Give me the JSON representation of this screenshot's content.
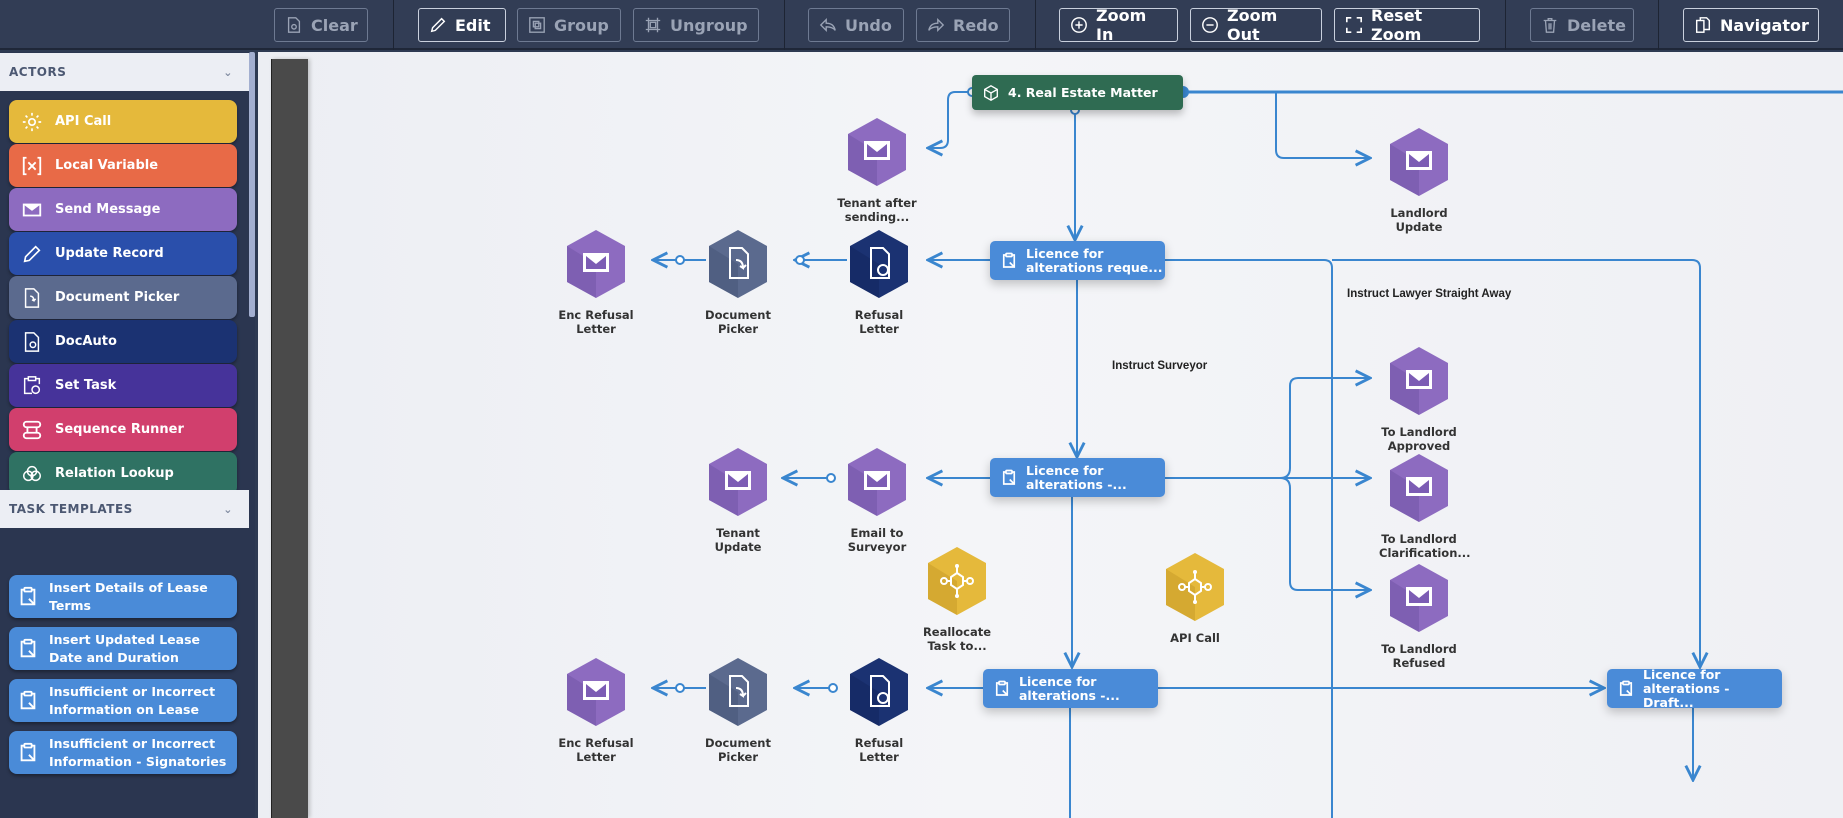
{
  "toolbar": {
    "clear": "Clear",
    "edit": "Edit",
    "group": "Group",
    "ungroup": "Ungroup",
    "undo": "Undo",
    "redo": "Redo",
    "zoom_in": "Zoom In",
    "zoom_out": "Zoom Out",
    "reset_zoom": "Reset Zoom",
    "delete": "Delete",
    "navigator": "Navigator"
  },
  "sidebar": {
    "actors_header": "ACTORS",
    "actors": [
      {
        "label": "API Call",
        "icon": "gear-icon",
        "color": "#e5b93b"
      },
      {
        "label": "Local Variable",
        "icon": "variable-icon",
        "color": "#e86a47"
      },
      {
        "label": "Send Message",
        "icon": "envelope-icon",
        "color": "#8d6bc0"
      },
      {
        "label": "Update Record",
        "icon": "pencil-icon",
        "color": "#2a4fab"
      },
      {
        "label": "Document Picker",
        "icon": "document-picker-icon",
        "color": "#5b6a8e"
      },
      {
        "label": "DocAuto",
        "icon": "doc-auto-icon",
        "color": "#1b3272"
      },
      {
        "label": "Set Task",
        "icon": "set-task-icon",
        "color": "#46339a"
      },
      {
        "label": "Sequence Runner",
        "icon": "sequence-icon",
        "color": "#d13f6d"
      },
      {
        "label": "Relation Lookup",
        "icon": "relation-icon",
        "color": "#2f7263"
      }
    ],
    "templates_header": "TASK TEMPLATES",
    "templates": [
      {
        "label": "Insert Details of Lease Terms"
      },
      {
        "label": "Insert Updated Lease Date and Duration"
      },
      {
        "label": "Insufficient or Incorrect Information on Lease"
      },
      {
        "label": "Insufficient or Incorrect Information - Signatories"
      }
    ]
  },
  "canvas": {
    "matter": {
      "label": "4. Real Estate Matter",
      "color": "#2f6b52"
    },
    "tasks": [
      {
        "label_1": "Licence for",
        "label_2": "alterations reque..."
      },
      {
        "label_1": "Licence for",
        "label_2": "alterations -..."
      },
      {
        "label_1": "Licence for",
        "label_2": "alterations -..."
      },
      {
        "label_1": "Licence for",
        "label_2": "alterations - Draft..."
      }
    ],
    "nodes": [
      {
        "label": "Tenant after sending...",
        "type": "send-message"
      },
      {
        "label": "Landlord Update",
        "type": "send-message"
      },
      {
        "label": "Enc Refusal Letter",
        "type": "send-message"
      },
      {
        "label": "Document Picker",
        "type": "document-picker"
      },
      {
        "label": "Refusal Letter",
        "type": "doc-auto"
      },
      {
        "label": "Tenant Update",
        "type": "send-message"
      },
      {
        "label": "Email to Surveyor",
        "type": "send-message"
      },
      {
        "label": "To Landlord Approved",
        "type": "send-message"
      },
      {
        "label": "To Landlord Clarification...",
        "type": "send-message"
      },
      {
        "label": "To Landlord Refused",
        "type": "send-message"
      },
      {
        "label": "Reallocate Task to...",
        "type": "api-call"
      },
      {
        "label": "API Call",
        "type": "api-call"
      },
      {
        "label": "Enc Refusal Letter",
        "type": "send-message"
      },
      {
        "label": "Document Picker",
        "type": "document-picker"
      },
      {
        "label": "Refusal Letter",
        "type": "doc-auto"
      }
    ],
    "annotations": {
      "instruct_surveyor": "Instruct Surveyor",
      "instruct_lawyer": "Instruct Lawyer Straight Away"
    }
  }
}
